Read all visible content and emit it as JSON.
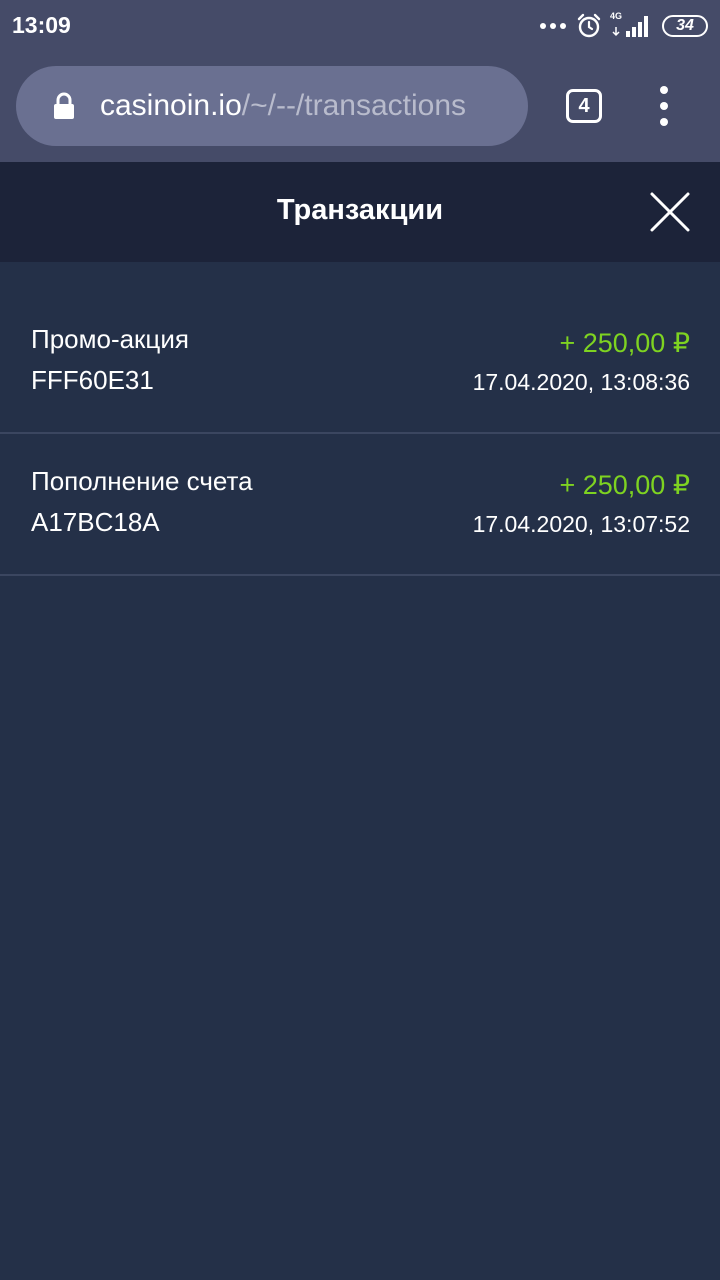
{
  "status_bar": {
    "time": "13:09",
    "network": "4G",
    "battery": "34",
    "icons": [
      "more-dots-icon",
      "alarm-icon",
      "signal-icon",
      "battery-icon"
    ]
  },
  "browser": {
    "url_host": "casinoin.io",
    "url_path": "/~/--/transactions",
    "tab_count": "4",
    "icons": [
      "lock-icon",
      "menu-icon"
    ]
  },
  "page": {
    "title": "Транзакции",
    "close_icon": "close-icon"
  },
  "transactions": [
    {
      "title": "Промо-акция",
      "id": "FFF60E31",
      "amount": "+ 250,00 ₽",
      "datetime": "17.04.2020, 13:08:36"
    },
    {
      "title": "Пополнение счета",
      "id": "A17BC18A",
      "amount": "+ 250,00 ₽",
      "datetime": "17.04.2020, 13:07:52"
    }
  ],
  "colors": {
    "chrome_bg": "#454b68",
    "url_bar_bg": "#6a7091",
    "header_bg": "#1c2339",
    "page_bg": "#243048",
    "amount_positive": "#7ed321",
    "divider": "#3b4660"
  }
}
